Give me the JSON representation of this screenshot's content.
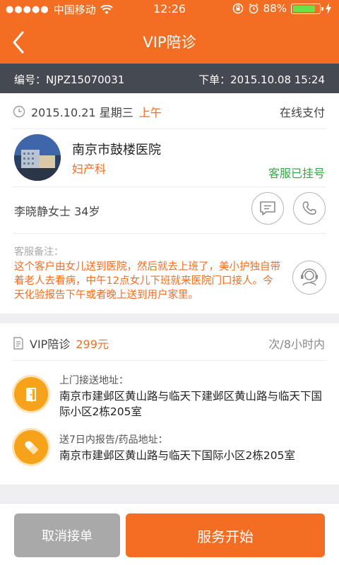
{
  "status_bar": {
    "carrier": "中国移动",
    "time": "12:26",
    "battery": "88%",
    "battery_fraction": 0.88
  },
  "nav": {
    "title": "VIP陪诊"
  },
  "order": {
    "id_text": "编号：NJPZ15070031",
    "placed_text": "下单：2015.10.08 15:24"
  },
  "appointment": {
    "date": "2015.10.21 星期三",
    "period": "上午",
    "payment": "在线支付"
  },
  "hospital": {
    "name": "南京市鼓楼医院",
    "department": "妇产科",
    "status": "客服已挂号"
  },
  "patient": {
    "info": "李晓静女士 34岁"
  },
  "note": {
    "label": "客服备注：",
    "text": "这个客户由女儿送到医院，然后就去上班了，美小护独自带着老人去看病，中午12点女儿下班就来医院门口接人。今天化验报告下午或者晚上送到用户家里。"
  },
  "service": {
    "name": "VIP陪诊",
    "price": "299元",
    "unit": "次/8小时内"
  },
  "pickup": {
    "label": "上门接送地址：",
    "address": "南京市建邺区黄山路与临天下建邺区黄山路与临天下国际小区2栋205室"
  },
  "delivery": {
    "label": "送7日内报告/药品地址：",
    "address": "南京市建邺区黄山路与临天下国际小区2栋205室"
  },
  "actions": {
    "cancel": "取消接单",
    "start": "服务开始"
  },
  "colors": {
    "brand": "#f36d22",
    "dark_bar": "#454a52",
    "success": "#33a845",
    "address_icon": "#f6a21a"
  }
}
